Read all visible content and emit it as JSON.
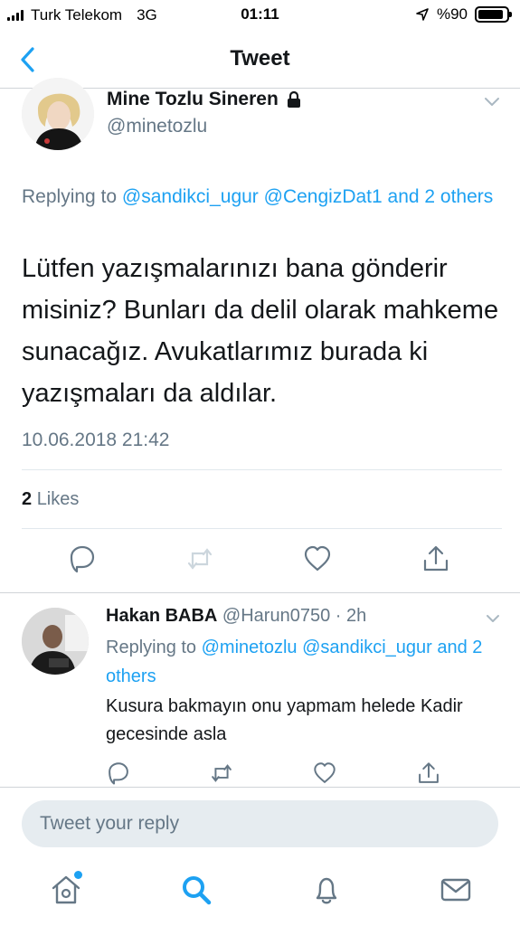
{
  "status_bar": {
    "carrier": "Turk Telekom",
    "network": "3G",
    "time": "01:11",
    "battery": "%90",
    "battery_level": 0.9
  },
  "nav": {
    "title": "Tweet",
    "back_icon": "chevron-left-icon"
  },
  "tweet": {
    "display_name": "Mine Tozlu Sineren",
    "handle": "@minetozlu",
    "replying_prefix": "Replying to",
    "replying_links": "@sandikci_ugur @CengizDat1 and 2 others",
    "text": "Lütfen yazışmalarınızı bana gönderir misiniz? Bunları da delil olarak mahkeme sunacağız. Avukatlarımız burada ki yazışmaları da aldılar.",
    "timestamp": "10.06.2018 21:42",
    "likes_count": "2",
    "likes_label": "Likes"
  },
  "reply": {
    "display_name": "Hakan BABA",
    "meta": "@Harun0750 · 2h",
    "replying_prefix": "Replying to",
    "replying_links": "@minetozlu @sandikci_ugur and 2 others",
    "text": "Kusura bakmayın onu yapmam helede Kadir gecesinde asla"
  },
  "composer": {
    "placeholder": "Tweet your reply"
  },
  "colors": {
    "accent": "#1da1f2",
    "secondary_text": "#657786",
    "divider": "#e1e8ed"
  }
}
